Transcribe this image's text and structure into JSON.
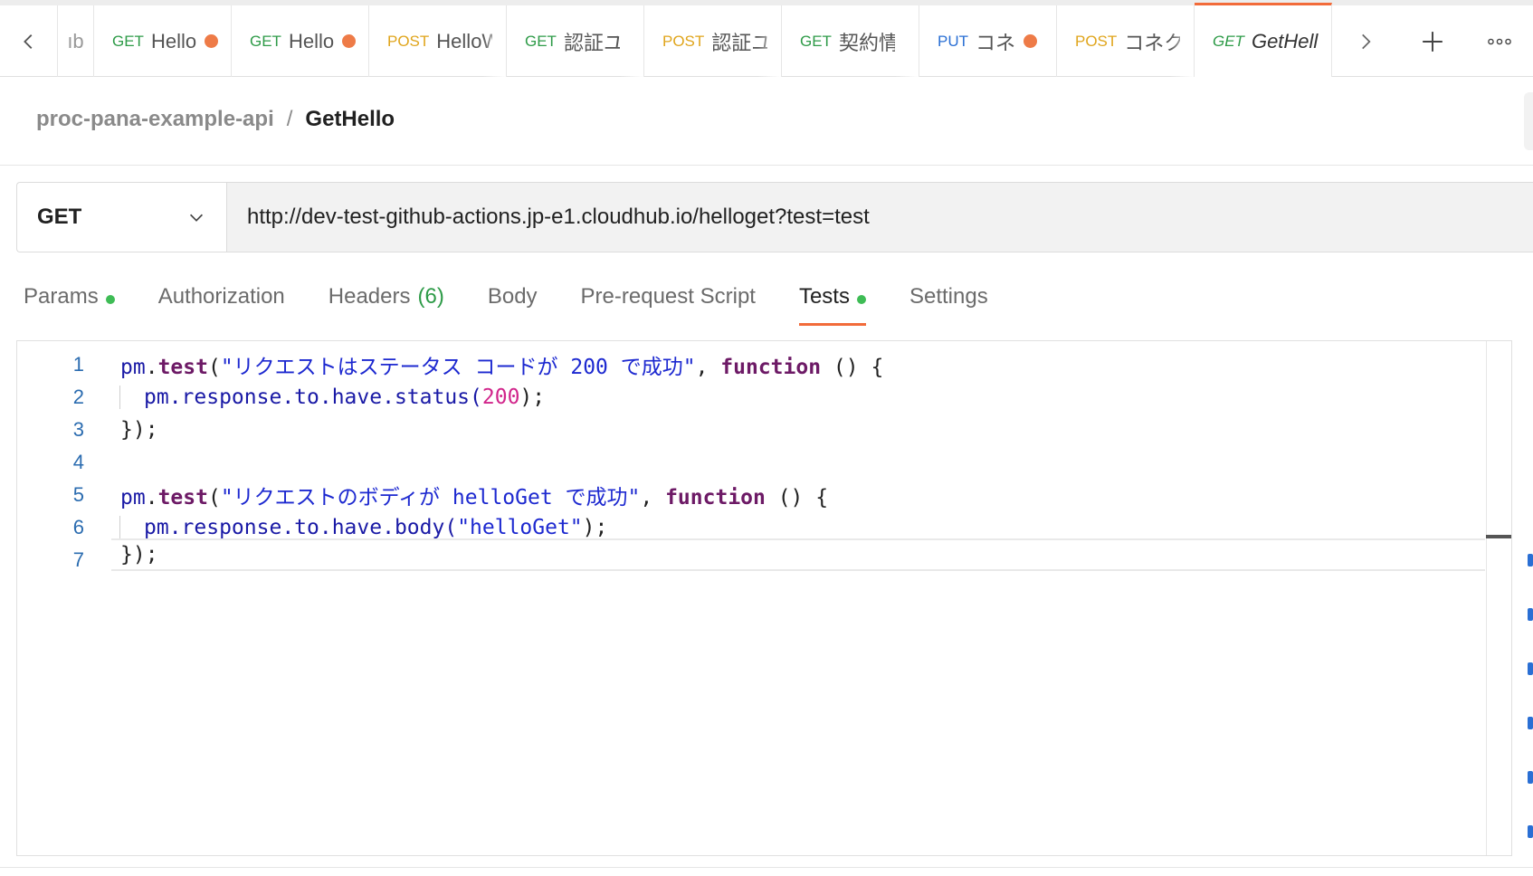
{
  "tabbar": {
    "first_tab_fragment": "ıb",
    "tabs": [
      {
        "method": "GET",
        "name": "Hello",
        "dirty": true
      },
      {
        "method": "GET",
        "name": "Hello",
        "dirty": true
      },
      {
        "method": "POST",
        "name": "HelloW",
        "dirty": false
      },
      {
        "method": "GET",
        "name": "認証ユー",
        "dirty": false
      },
      {
        "method": "POST",
        "name": "認証ユ",
        "dirty": false
      },
      {
        "method": "GET",
        "name": "契約情報",
        "dirty": false
      },
      {
        "method": "PUT",
        "name": "コネ",
        "dirty": true
      },
      {
        "method": "POST",
        "name": "コネク",
        "dirty": false
      }
    ],
    "active_tab": {
      "method": "GET",
      "name": "GetHello"
    }
  },
  "breadcrumb": {
    "collection": "proc-pana-example-api",
    "separator": "/",
    "request": "GetHello"
  },
  "request": {
    "method": "GET",
    "url": "http://dev-test-github-actions.jp-e1.cloudhub.io/helloget?test=test"
  },
  "request_tabs": [
    {
      "label": "Params",
      "dot": true
    },
    {
      "label": "Authorization"
    },
    {
      "label": "Headers",
      "count": "(6)"
    },
    {
      "label": "Body"
    },
    {
      "label": "Pre-request Script"
    },
    {
      "label": "Tests",
      "dot": true,
      "active": true
    },
    {
      "label": "Settings"
    }
  ],
  "editor": {
    "line_numbers": [
      "1",
      "2",
      "3",
      "4",
      "5",
      "6",
      "7"
    ],
    "lines": [
      {
        "obj": "pm",
        "dot": ".",
        "fn": "test",
        "open": "(",
        "str": "\"リクエストはステータス コードが 200 で成功\"",
        "comma": ", ",
        "kw": "function",
        "rest": " () {"
      },
      {
        "a": "pm.response.to.have.status(",
        "num": "200",
        "b": ");"
      },
      {
        "text": "});"
      },
      {
        "text": ""
      },
      {
        "obj": "pm",
        "dot": ".",
        "fn": "test",
        "open": "(",
        "str": "\"リクエストのボディが helloGet で成功\"",
        "comma": ", ",
        "kw": "function",
        "rest": " () {"
      },
      {
        "a": "pm.response.to.have.body(",
        "str": "\"helloGet\"",
        "b": ");"
      },
      {
        "text": "});"
      }
    ]
  },
  "colors": {
    "accent": "#f26b3a",
    "dirty_dot": "#ee7b47",
    "get": "#2e9b48",
    "post": "#e0a51c",
    "put": "#2a6fd4",
    "status_dot": "#3ebc55"
  }
}
